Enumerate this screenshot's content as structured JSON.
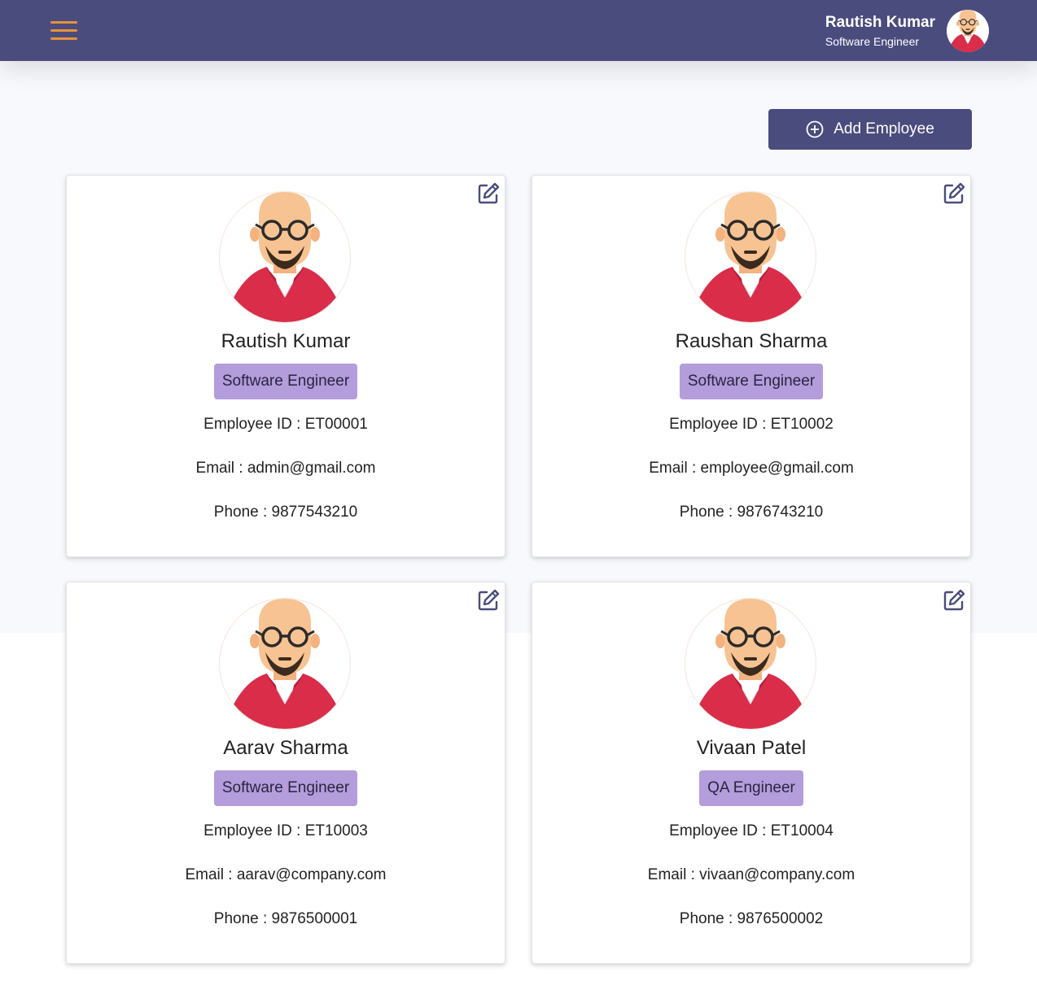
{
  "header": {
    "user_name": "Rautish Kumar",
    "user_role": "Software Engineer",
    "menu_icon": "hamburger-menu-icon",
    "avatar_icon": "user-avatar"
  },
  "actions": {
    "add_employee_label": "Add Employee",
    "add_icon": "plus-circle-icon"
  },
  "colors": {
    "header_bg": "#4a4c7e",
    "accent": "#e8923a",
    "badge_bg": "#b39ddb",
    "page_bg": "#f8f9fc"
  },
  "employees": [
    {
      "name": "Rautish Kumar",
      "role": "Software Engineer",
      "id_label": "Employee ID : ET00001",
      "email_label": "Email : admin@gmail.com",
      "phone_label": "Phone : 9877543210"
    },
    {
      "name": "Raushan Sharma",
      "role": "Software Engineer",
      "id_label": "Employee ID : ET10002",
      "email_label": "Email : employee@gmail.com",
      "phone_label": "Phone : 9876743210"
    },
    {
      "name": "Aarav Sharma",
      "role": "Software Engineer",
      "id_label": "Employee ID : ET10003",
      "email_label": "Email : aarav@company.com",
      "phone_label": "Phone : 9876500001"
    },
    {
      "name": "Vivaan Patel",
      "role": "QA Engineer",
      "id_label": "Employee ID : ET10004",
      "email_label": "Email : vivaan@company.com",
      "phone_label": "Phone : 9876500002"
    }
  ]
}
